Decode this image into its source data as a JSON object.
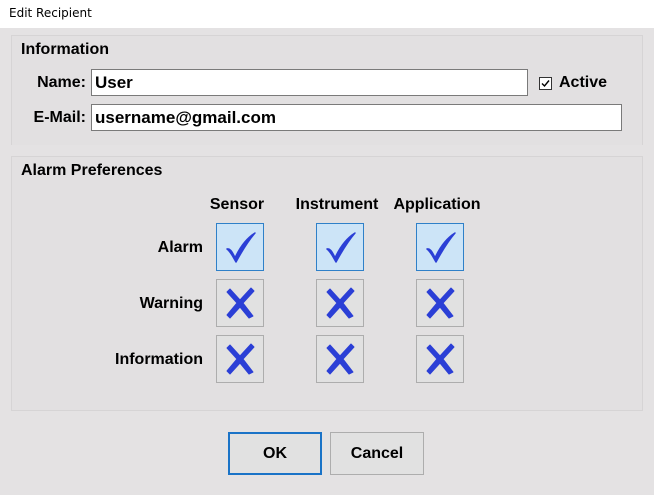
{
  "window": {
    "title": "Edit Recipient"
  },
  "information": {
    "group_title": "Information",
    "name_label": "Name:",
    "name_value": "User",
    "email_label": "E-Mail:",
    "email_value": "username@gmail.com",
    "active_label": "Active",
    "active_checked": true
  },
  "alarm_preferences": {
    "group_title": "Alarm Preferences",
    "columns": [
      "Sensor",
      "Instrument",
      "Application"
    ],
    "rows": [
      {
        "label": "Alarm",
        "values": [
          true,
          true,
          true
        ]
      },
      {
        "label": "Warning",
        "values": [
          false,
          false,
          false
        ]
      },
      {
        "label": "Information",
        "values": [
          false,
          false,
          false
        ]
      }
    ],
    "icons": {
      "checked": "checkmark-icon",
      "unchecked": "x-mark-icon"
    },
    "colors": {
      "mark": "#2b3fd6",
      "checked_bg": "#cce4f7",
      "checked_border": "#2f80c8"
    }
  },
  "buttons": {
    "ok_label": "OK",
    "cancel_label": "Cancel"
  }
}
